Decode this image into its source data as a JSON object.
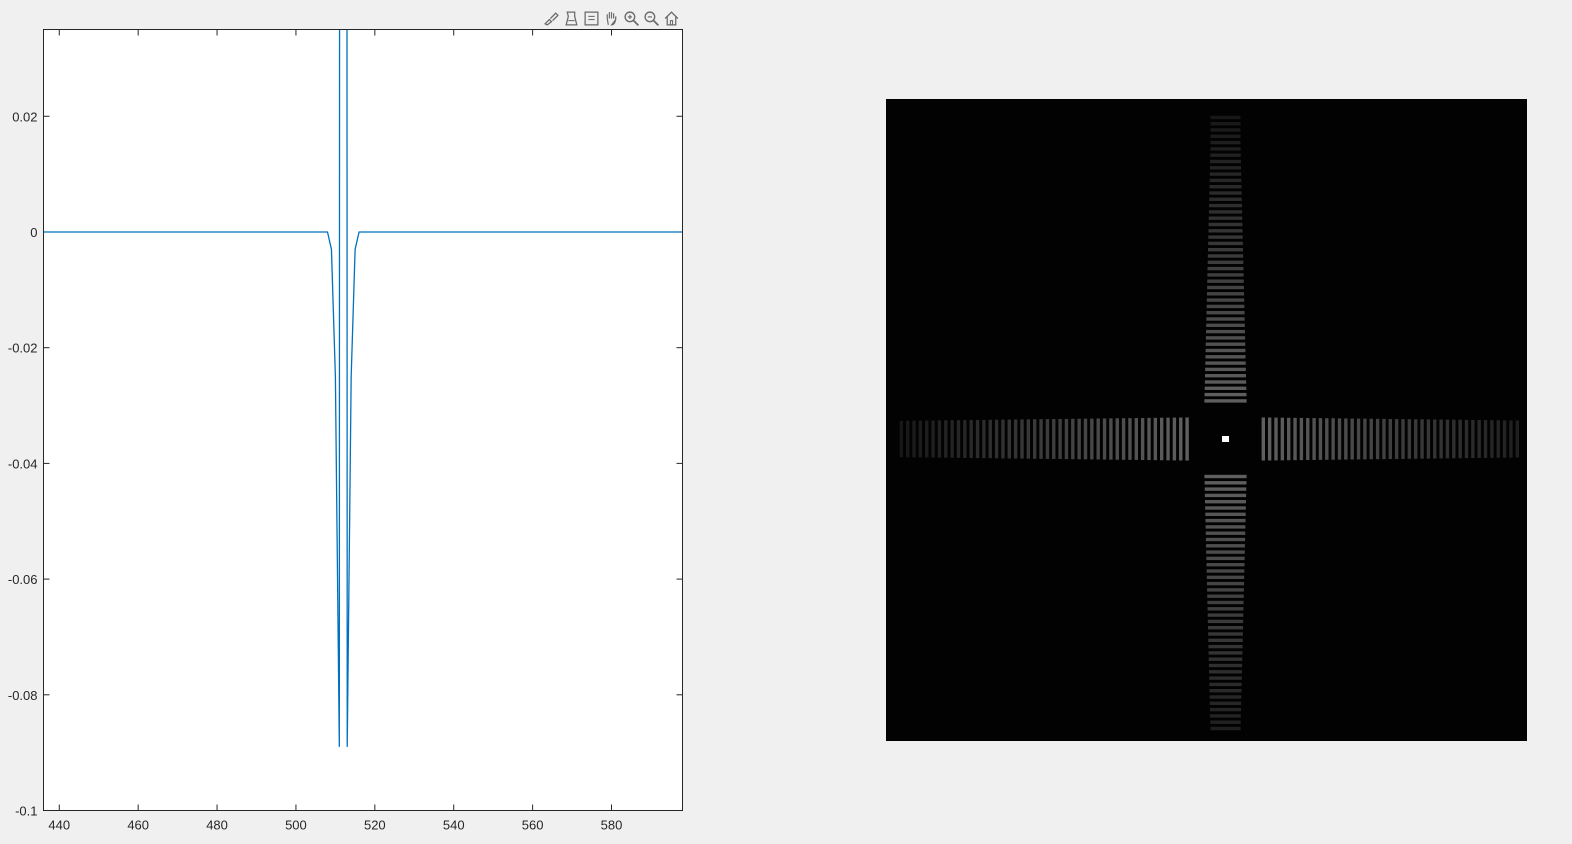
{
  "toolbar": {
    "icons": [
      "brush-icon",
      "data-tips-icon",
      "legend-icon",
      "pan-icon",
      "zoom-in-icon",
      "zoom-out-icon",
      "home-icon"
    ]
  },
  "chart_data": [
    {
      "type": "line",
      "xlim": [
        436,
        598
      ],
      "ylim": [
        -0.1,
        0.035
      ],
      "xticks": [
        440,
        460,
        480,
        500,
        520,
        540,
        560,
        580
      ],
      "xtick_labels": [
        "440",
        "460",
        "480",
        "500",
        "520",
        "540",
        "560",
        "580"
      ],
      "yticks": [
        0.02,
        0,
        -0.02,
        -0.04,
        -0.06,
        -0.08,
        -0.1
      ],
      "ytick_labels": [
        "0.02",
        "0",
        "-0.02",
        "-0.04",
        "-0.06",
        "-0.08",
        "-0.1"
      ],
      "grid": false,
      "line_color": "#0072bd",
      "series": [
        {
          "x": [
            436,
            480,
            500,
            505,
            508,
            509,
            510,
            511,
            511.5,
            512,
            512.5,
            513,
            514,
            515,
            516,
            517,
            520,
            540,
            598
          ],
          "y": [
            0,
            0,
            0,
            0,
            0,
            -0.003,
            -0.025,
            -0.089,
            1.0,
            1.0,
            1.0,
            -0.089,
            -0.025,
            -0.003,
            0,
            0,
            0,
            0,
            0
          ]
        }
      ]
    },
    {
      "type": "heatmap",
      "colormap": "gray",
      "background": "#020202",
      "pattern": "cross-shaped banded spectrum with bright center point"
    }
  ]
}
